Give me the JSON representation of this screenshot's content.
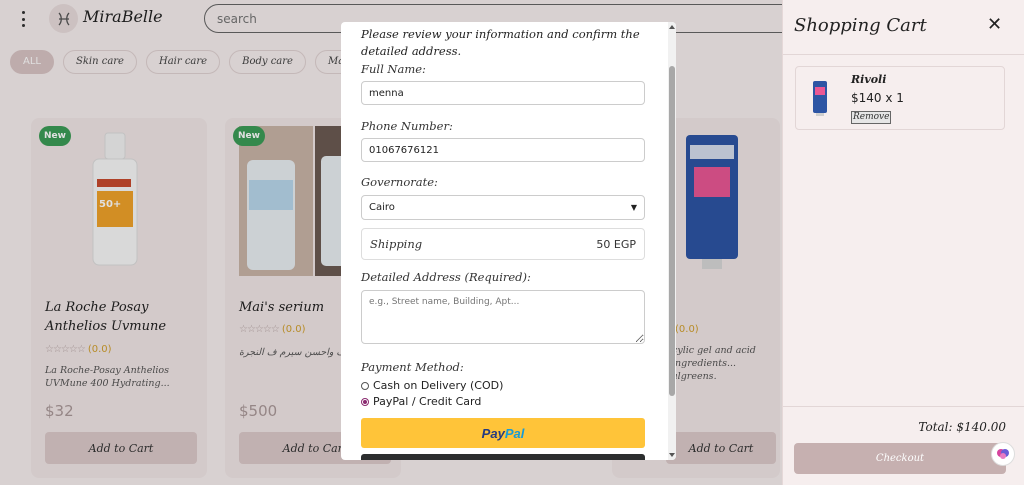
{
  "app": {
    "brand": "MiraBelle",
    "search_placeholder": "search"
  },
  "categories": [
    "ALL",
    "Skin care",
    "Hair care",
    "Body care",
    "Makeup"
  ],
  "products": [
    {
      "badge": "New",
      "title": "La Roche Posay Anthelios Uvmune",
      "rating": "(0.0)",
      "desc": "La Roche-Posay Anthelios UVMune 400 Hydrating...",
      "price": "$32",
      "button": "Add to Cart"
    },
    {
      "badge": "New",
      "title": "Mai's serium",
      "rating": "(0.0)",
      "desc": "الحف واحسن سيرم ف النجرة",
      "price": "$500",
      "button": "Add to Cart"
    },
    {
      "badge": "",
      "title": "",
      "rating": "(0.0)",
      "desc": "cylic gel and acid ingredients... algreens.",
      "price": "",
      "button": "Add to Cart"
    }
  ],
  "checkout_modal": {
    "intro": "Please review your information and confirm the detailed address.",
    "full_name_label": "Full Name:",
    "full_name_value": "menna",
    "phone_label": "Phone Number:",
    "phone_value": "01067676121",
    "governorate_label": "Governorate:",
    "governorate_value": "Cairo",
    "shipping_label": "Shipping",
    "shipping_value": "50 EGP",
    "address_label": "Detailed Address (Required):",
    "address_placeholder": "e.g., Street name, Building, Apt...",
    "payment_label": "Payment Method:",
    "payment_options": [
      {
        "label": "Cash on Delivery (COD)",
        "checked": false
      },
      {
        "label": "PayPal / Credit Card",
        "checked": true
      }
    ],
    "paypal_left": "Pay",
    "paypal_right": "Pal"
  },
  "cart": {
    "title": "Shopping Cart",
    "items": [
      {
        "name": "Rivoli",
        "qty": "$140 x 1",
        "remove": "Remove"
      }
    ],
    "total": "Total: $140.00",
    "checkout": "Checkout"
  },
  "colors": {
    "accent": "#3c9c57",
    "paypal": "#ffc439",
    "background": "#f6eeee"
  }
}
